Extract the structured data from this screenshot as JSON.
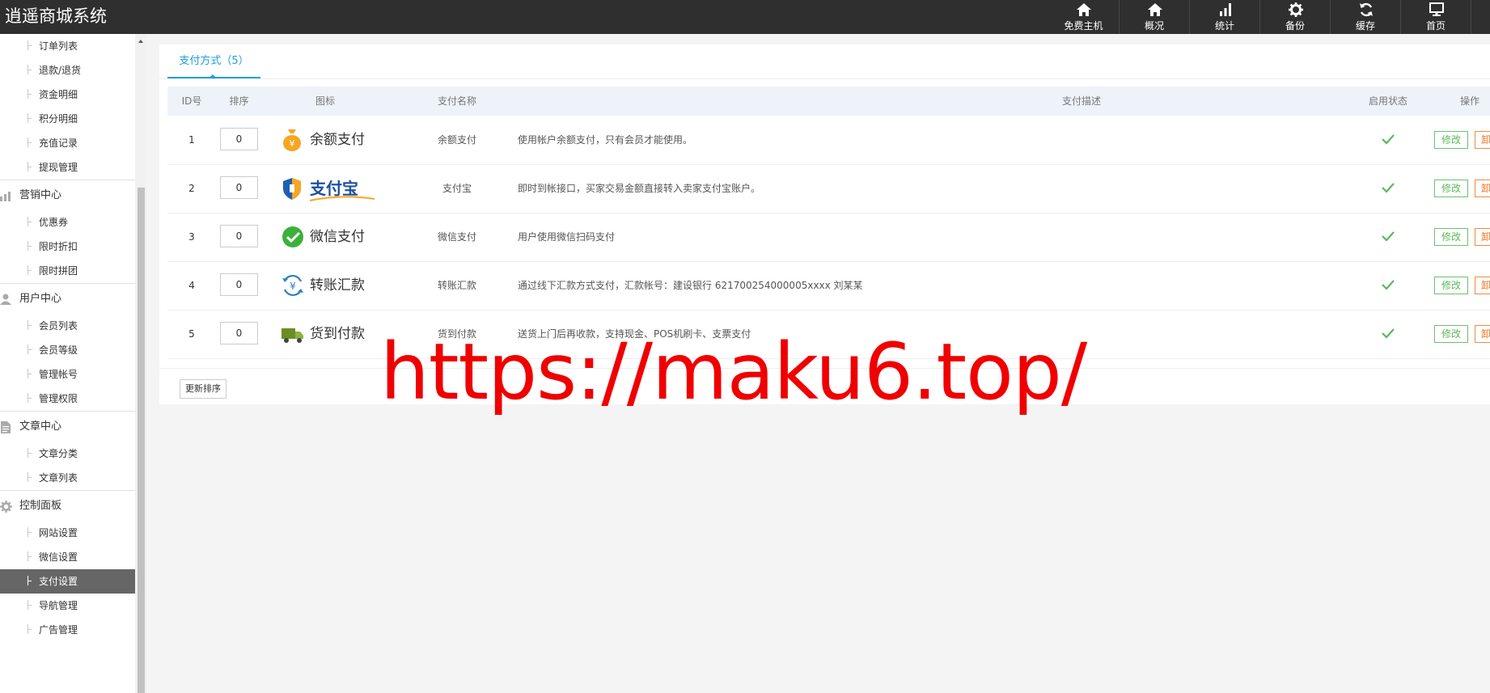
{
  "brand": "逍遥商城系统",
  "topnav": [
    {
      "label": "免费主机",
      "icon": "home-icon"
    },
    {
      "label": "概况",
      "icon": "home-icon"
    },
    {
      "label": "统计",
      "icon": "bar-chart-icon"
    },
    {
      "label": "备份",
      "icon": "gear-icon"
    },
    {
      "label": "缓存",
      "icon": "refresh-icon"
    },
    {
      "label": "首页",
      "icon": "monitor-icon"
    }
  ],
  "sidebar": {
    "orders": [
      "订单列表",
      "退款/退货",
      "资金明细",
      "积分明细",
      "充值记录",
      "提现管理"
    ],
    "marketing": {
      "title": "营销中心",
      "items": [
        "优惠券",
        "限时折扣",
        "限时拼团"
      ]
    },
    "users": {
      "title": "用户中心",
      "items": [
        "会员列表",
        "会员等级",
        "管理帐号",
        "管理权限"
      ]
    },
    "articles": {
      "title": "文章中心",
      "items": [
        "文章分类",
        "文章列表"
      ]
    },
    "control": {
      "title": "控制面板",
      "items": [
        "网站设置",
        "微信设置",
        "支付设置",
        "导航管理",
        "广告管理"
      ]
    },
    "active_item": "支付设置"
  },
  "tab": {
    "label": "支付方式（5）"
  },
  "table": {
    "headers": {
      "id": "ID号",
      "sort": "排序",
      "icon": "图标",
      "name": "支付名称",
      "desc": "支付描述",
      "status": "启用状态",
      "ops": "操作"
    },
    "rows": [
      {
        "id": "1",
        "sort": "0",
        "logo_text": "余额支付",
        "logo_icon": "money-bag-icon",
        "name": "余额支付",
        "desc": "使用帐户余额支付，只有会员才能使用。",
        "enabled": true
      },
      {
        "id": "2",
        "sort": "0",
        "logo_text": "支付宝",
        "logo_icon": "alipay-shield-icon",
        "name": "支付宝",
        "desc": "即时到帐接口，买家交易金额直接转入卖家支付宝账户。",
        "enabled": true
      },
      {
        "id": "3",
        "sort": "0",
        "logo_text": "微信支付",
        "logo_icon": "wechat-icon",
        "name": "微信支付",
        "desc": "用户使用微信扫码支付",
        "enabled": true
      },
      {
        "id": "4",
        "sort": "0",
        "logo_text": "转账汇款",
        "logo_icon": "transfer-yen-icon",
        "name": "转账汇款",
        "desc": "通过线下汇款方式支付，汇款帐号：建设银行 621700254000005xxxx 刘某某",
        "enabled": true
      },
      {
        "id": "5",
        "sort": "0",
        "logo_text": "货到付款",
        "logo_icon": "truck-icon",
        "name": "货到付款",
        "desc": "送货上门后再收款，支持现金、POS机刷卡、支票支付",
        "enabled": true
      }
    ],
    "edit_label": "修改",
    "delete_label": "卸载"
  },
  "sort_button_label": "更新排序",
  "watermark": "https://maku6.top/",
  "colors": {
    "accent": "#1e9fdc",
    "topbar": "#2f2f2f",
    "check": "#5cb85c",
    "edit": "#5cb85c",
    "delete": "#f0731f",
    "watermark": "#f00000"
  }
}
